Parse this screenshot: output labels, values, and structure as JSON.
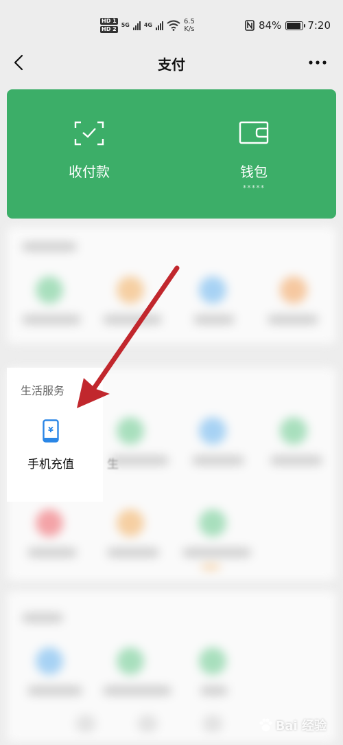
{
  "status_bar": {
    "hd1": "HD 1",
    "hd2": "HD 2",
    "net1": "5G",
    "net2": "4G",
    "speed_value": "6.5",
    "speed_unit": "K/s",
    "battery": "84%",
    "time": "7:20"
  },
  "nav": {
    "title": "支付",
    "back_icon": "chevron-left-icon",
    "more_icon": "more-dots-icon"
  },
  "wallet_card": {
    "color": "#3cae68",
    "receive_pay_label": "收付款",
    "wallet_label": "钱包",
    "wallet_balance": "*****"
  },
  "life_services": {
    "title": "生活服务",
    "mobile_recharge_label": "手机充值",
    "next_item_peek": "生"
  },
  "annotation": {
    "arrow_color": "#c1272d"
  },
  "watermark": {
    "text": "Bai 经验"
  }
}
